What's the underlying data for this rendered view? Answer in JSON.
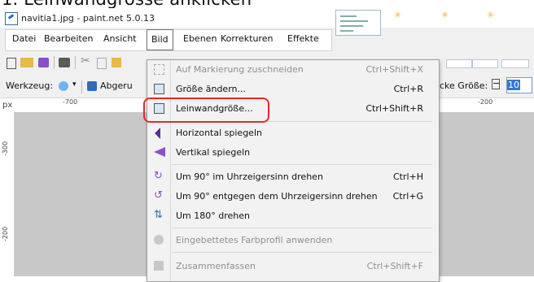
{
  "heading": "1. Leinwandgrösse anklicken",
  "window": {
    "title": "navitia1.jpg - paint.net 5.0.13"
  },
  "menubar": {
    "items": [
      "Datei",
      "Bearbeiten",
      "Ansicht",
      "Bild",
      "Ebenen",
      "Korrekturen",
      "Effekte"
    ],
    "active_index": 3
  },
  "toolbar2": {
    "werkzeug_label": "Werkzeug:",
    "abgeru_label": "Abgeru",
    "size_label": "cke Größe:",
    "size_value": "10"
  },
  "ruler": {
    "unit": "px",
    "marks": [
      "-700",
      "-200"
    ]
  },
  "vruler": {
    "marks": [
      "-300",
      "-200"
    ]
  },
  "dropdown": {
    "items": [
      {
        "label": "Auf Markierung zuschneiden",
        "shortcut": "Ctrl+Shift+X",
        "icon": "crop-icon",
        "disabled": true
      },
      {
        "label": "Größe ändern...",
        "shortcut": "Ctrl+R",
        "icon": "resize-image-icon",
        "disabled": false
      },
      {
        "label": "Leinwandgröße...",
        "shortcut": "Ctrl+Shift+R",
        "icon": "canvas-size-icon",
        "disabled": false
      },
      {
        "label": "Horizontal spiegeln",
        "shortcut": "",
        "icon": "flip-horizontal-icon",
        "disabled": false
      },
      {
        "label": "Vertikal spiegeln",
        "shortcut": "",
        "icon": "flip-vertical-icon",
        "disabled": false
      },
      {
        "label": "Um 90° im Uhrzeigersinn drehen",
        "shortcut": "Ctrl+H",
        "icon": "rotate-clockwise-icon",
        "disabled": false
      },
      {
        "label": "Um 90° entgegen dem Uhrzeigersinn drehen",
        "shortcut": "Ctrl+G",
        "icon": "rotate-counterclockwise-icon",
        "disabled": false
      },
      {
        "label": "Um 180° drehen",
        "shortcut": "",
        "icon": "rotate-180-icon",
        "disabled": false
      },
      {
        "label": "Eingebettetes Farbprofil anwenden",
        "shortcut": "",
        "icon": "color-profile-icon",
        "disabled": true
      },
      {
        "label": "Zusammenfassen",
        "shortcut": "Ctrl+Shift+F",
        "icon": "flatten-icon",
        "disabled": true
      }
    ]
  },
  "colors": {
    "highlight": "#e22a2a",
    "accent_purple": "#8a4fc9",
    "accent_blue": "#2f6db5"
  }
}
